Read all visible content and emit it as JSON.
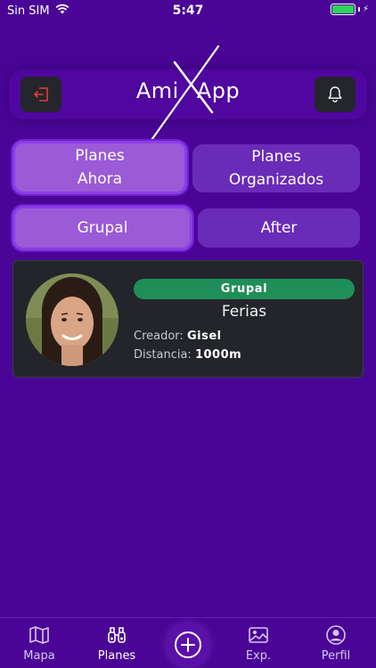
{
  "status_bar": {
    "carrier": "Sin SIM",
    "time": "5:47"
  },
  "header": {
    "logo_text": "AmixApp",
    "logo_part1": "Ami",
    "logo_part2": "App"
  },
  "tabs_row1": [
    {
      "label_line1": "Planes",
      "label_line2": "Ahora",
      "active": true
    },
    {
      "label_line1": "Planes",
      "label_line2": "Organizados",
      "active": false
    }
  ],
  "tabs_row2": [
    {
      "label": "Grupal",
      "active": true
    },
    {
      "label": "After",
      "active": false
    }
  ],
  "plan": {
    "badge": "Grupal",
    "title": "Ferias",
    "creator_label": "Creador:",
    "creator_value": "Gisel",
    "distance_label": "Distancia:",
    "distance_value": "1000m"
  },
  "bottom_nav": [
    {
      "label": "Mapa",
      "icon": "map-icon",
      "active": false
    },
    {
      "label": "Planes",
      "icon": "binoculars-icon",
      "active": true
    },
    {
      "label": "Exp.",
      "icon": "image-icon",
      "active": false
    },
    {
      "label": "Perfil",
      "icon": "user-icon",
      "active": false
    }
  ],
  "colors": {
    "background": "#4a0596",
    "accent_active_tab": "#9b5ad6",
    "badge_green": "#1f8e58",
    "card_bg": "#23252b",
    "logout_icon": "#e63a3a"
  }
}
